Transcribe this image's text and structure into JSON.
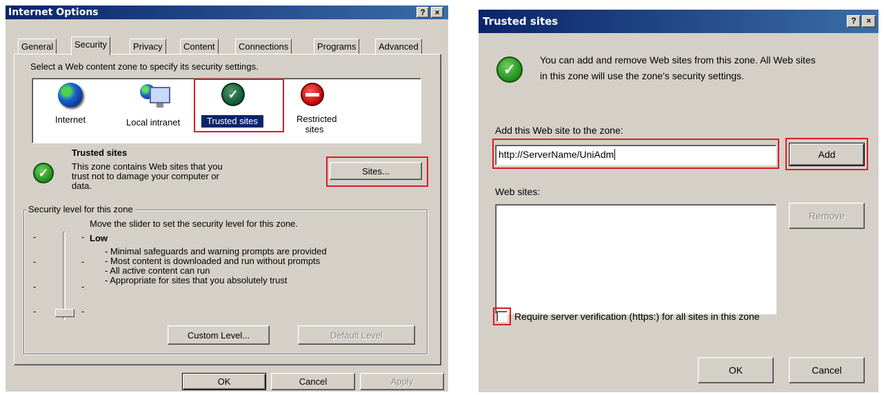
{
  "internet_options": {
    "title": "Internet Options",
    "help_btn": "?",
    "close_btn": "×",
    "tabs": [
      "General",
      "Security",
      "Privacy",
      "Content",
      "Connections",
      "Programs",
      "Advanced"
    ],
    "zone_prompt": "Select a Web content zone to specify its security settings.",
    "zones": [
      {
        "label": "Internet",
        "icon": "globe-icon"
      },
      {
        "label": "Local intranet",
        "icon": "computer-globe-icon"
      },
      {
        "label": "Trusted sites",
        "icon": "trusted-check-icon"
      },
      {
        "label": "Restricted sites",
        "icon": "no-entry-icon"
      }
    ],
    "zone_heading": "Trusted sites",
    "zone_desc": [
      "This zone contains Web sites that you",
      "trust not to damage your computer or",
      "data."
    ],
    "sites_button": "Sites...",
    "security_group": "Security level for this zone",
    "slider_hint": "Move the slider to set the security level for this zone.",
    "level_name": "Low",
    "level_items": [
      "- Minimal safeguards and warning prompts are provided",
      "- Most content is downloaded and run without prompts",
      "- All active content can run",
      "- Appropriate for sites that you absolutely trust"
    ],
    "custom_level": "Custom Level...",
    "default_level": "Default Level",
    "ok": "OK",
    "cancel": "Cancel",
    "apply": "Apply"
  },
  "trusted_sites": {
    "title": "Trusted sites",
    "help_btn": "?",
    "close_btn": "×",
    "info_lines": [
      "You can add and remove Web sites from this zone. All Web sites",
      "in this zone will use the zone's security settings."
    ],
    "add_label": "Add this Web site to the zone:",
    "add_value": "http://ServerName/UniAdm",
    "add_button": "Add",
    "websites_label": "Web sites:",
    "remove_button": "Remove",
    "require_label": "Require server verification (https:) for all sites in this zone",
    "ok": "OK",
    "cancel": "Cancel"
  }
}
